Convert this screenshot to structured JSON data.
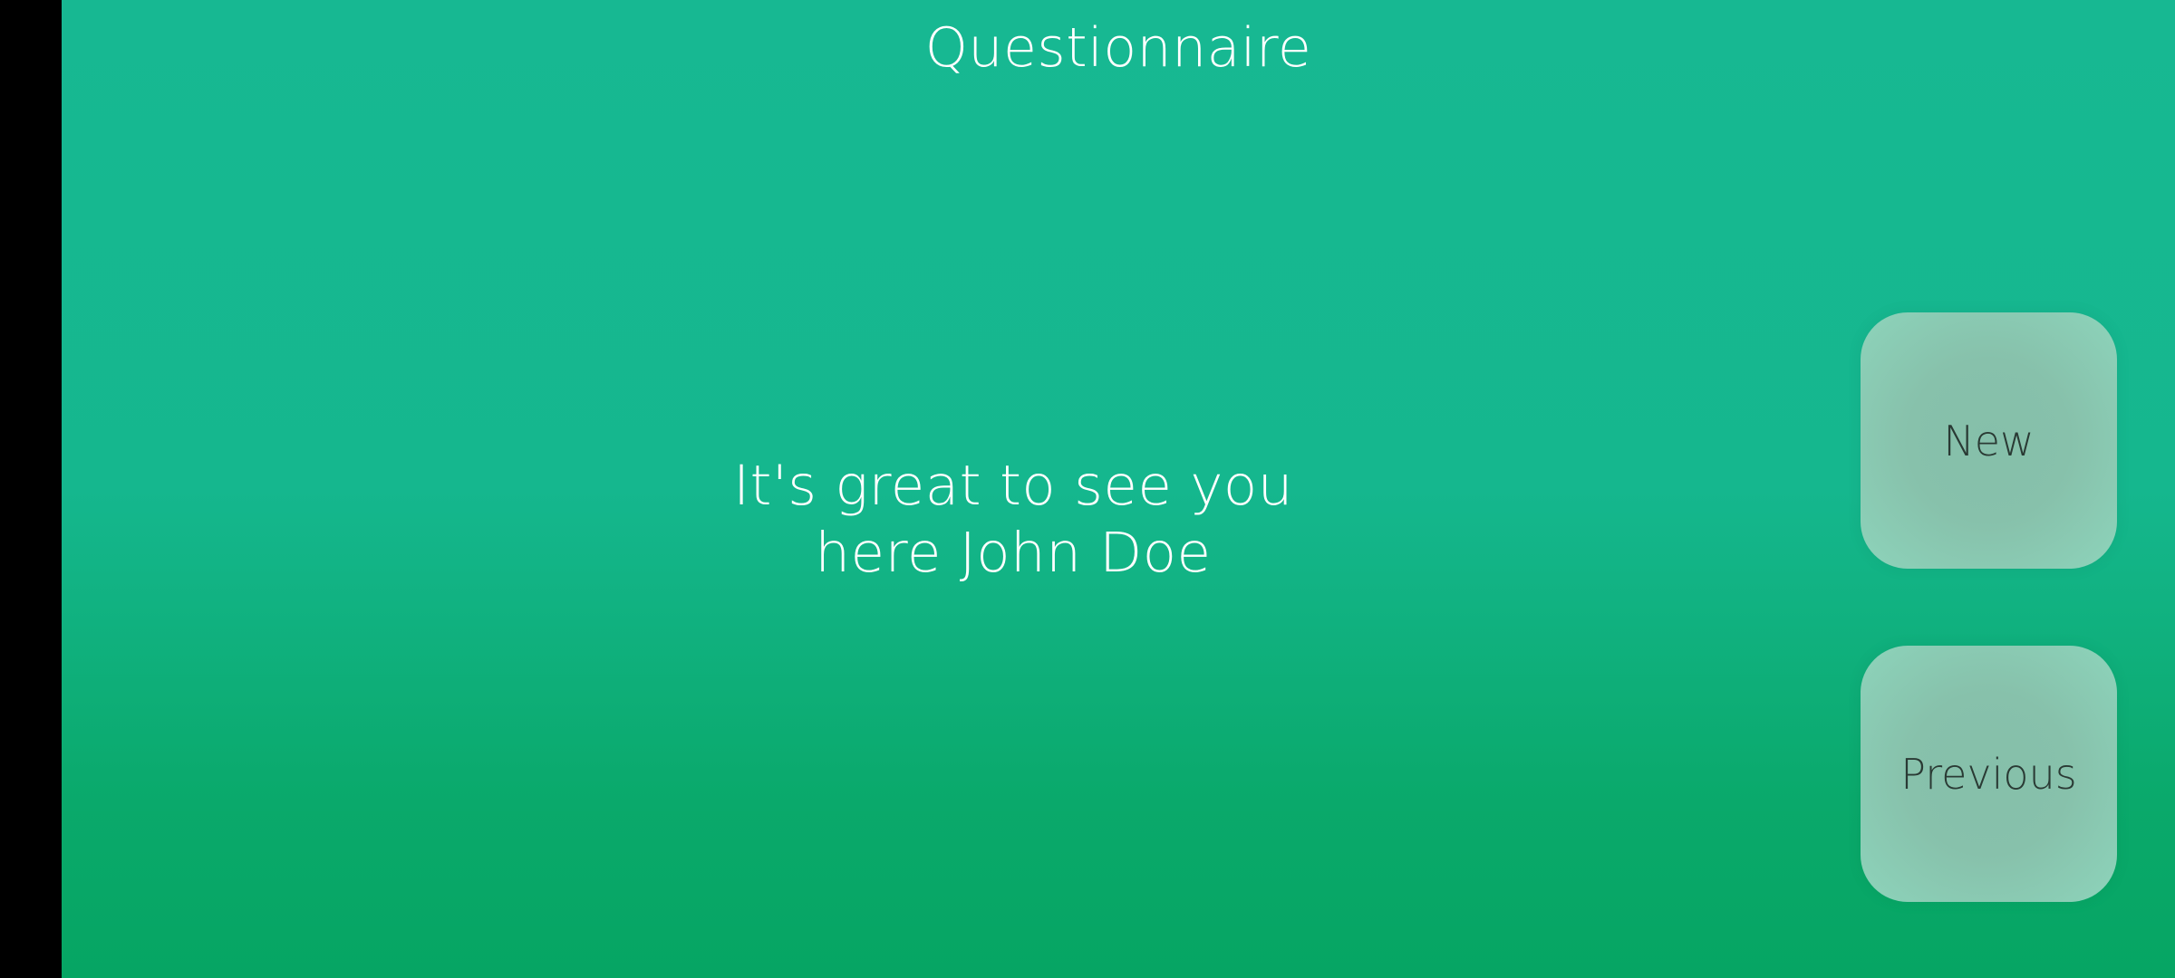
{
  "app": {
    "title": "Questionnaire",
    "background_colors": [
      "#17b892",
      "#06a563"
    ]
  },
  "main": {
    "greeting_line1": "It's great to see you",
    "greeting_line2": "here John Doe"
  },
  "actions": {
    "new_label": "New",
    "previous_label": "Previous",
    "button_color": "#87c1ab"
  }
}
